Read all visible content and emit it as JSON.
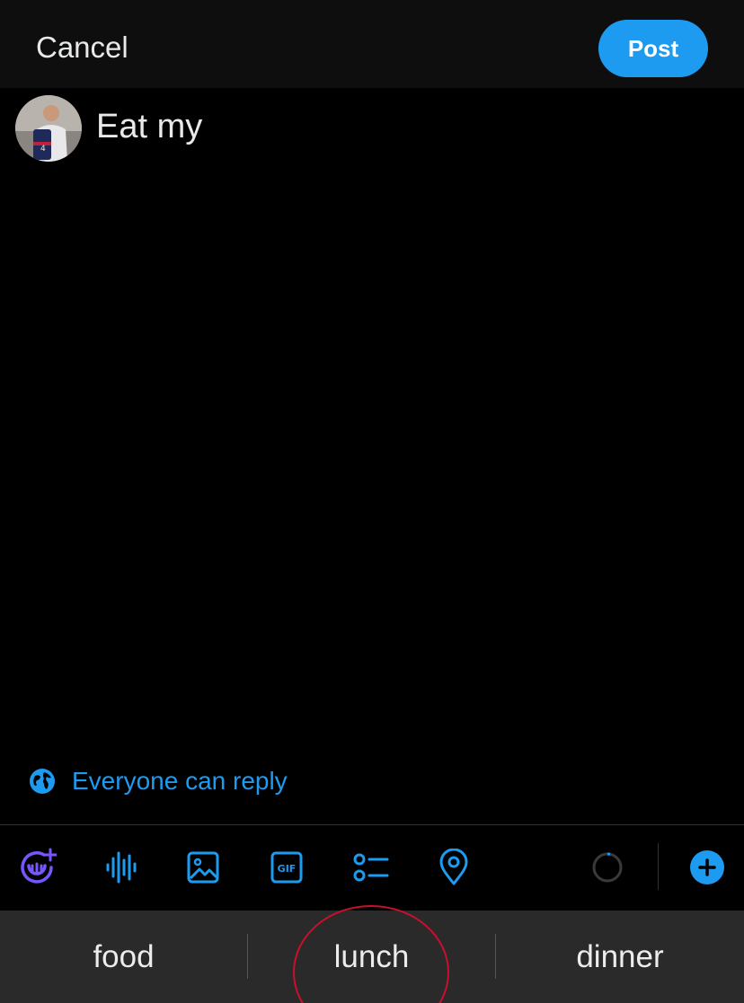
{
  "header": {
    "cancel_label": "Cancel",
    "post_label": "Post"
  },
  "compose": {
    "avatar_icon": "user-avatar-photo",
    "text": "Eat my"
  },
  "reply_setting": {
    "icon": "globe-icon",
    "label": "Everyone can reply"
  },
  "toolbar": {
    "icons": [
      "grok-image-plus-icon",
      "audio-waveform-icon",
      "image-icon",
      "gif-icon",
      "poll-list-icon",
      "location-pin-icon",
      "character-count-ring-icon",
      "add-thread-plus-icon"
    ],
    "gif_text": "GIF"
  },
  "keyboard_suggestions": {
    "items": [
      "food",
      "lunch",
      "dinner"
    ]
  },
  "colors": {
    "accent": "#1d9bf0",
    "grok_purple": "#7856ff",
    "annotation_red": "#c8102e"
  }
}
